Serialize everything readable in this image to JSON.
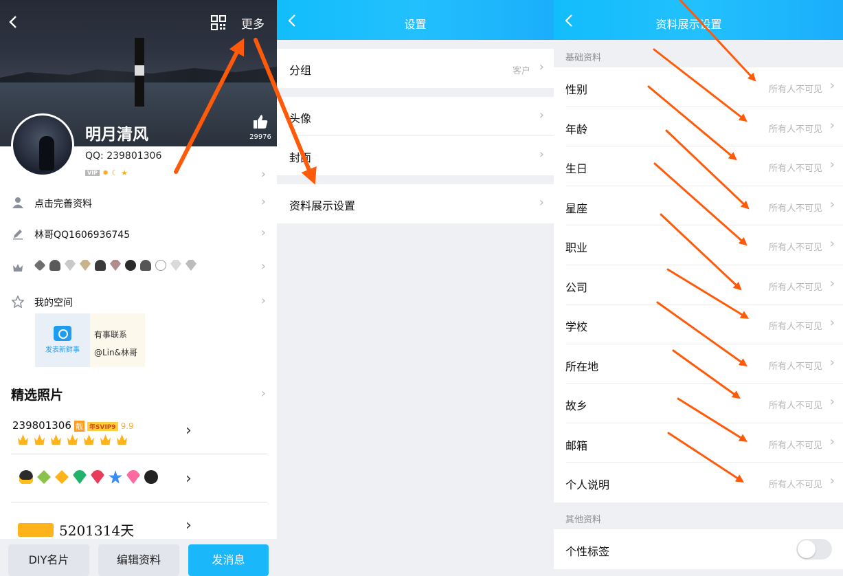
{
  "profile_panel": {
    "more_label": "更多",
    "nickname": "明月清风",
    "qq_number": "QQ: 239801306",
    "vip_badge": "VIP",
    "likes": "29976",
    "rows": [
      {
        "label": "点击完善资料"
      },
      {
        "label": "林哥QQ1606936745"
      },
      {
        "label": ""
      },
      {
        "label": "我的空间"
      }
    ],
    "space_card": {
      "post_label": "发表新鲜事",
      "text_line1": "有事联系",
      "text_line2": "@Lin&林哥"
    },
    "featured_title": "精选照片",
    "vip_row": {
      "qq": "239801306",
      "liang_tag": "靓",
      "svip_tag": "年SVIP9",
      "level": "9.9"
    },
    "days_row": {
      "value": "5201314天"
    },
    "buttons": {
      "diy": "DIY名片",
      "edit": "编辑资料",
      "message": "发消息"
    }
  },
  "settings_panel": {
    "title": "设置",
    "rows": [
      {
        "label": "分组",
        "value": "客户"
      },
      {
        "label": "头像",
        "value": ""
      },
      {
        "label": "封面",
        "value": ""
      },
      {
        "label": "资料展示设置",
        "value": ""
      }
    ]
  },
  "display_panel": {
    "title": "资料展示设置",
    "section_basic": "基础资料",
    "basic_rows": [
      {
        "label": "性别",
        "value": "所有人不可见"
      },
      {
        "label": "年龄",
        "value": "所有人不可见"
      },
      {
        "label": "生日",
        "value": "所有人不可见"
      },
      {
        "label": "星座",
        "value": "所有人不可见"
      },
      {
        "label": "职业",
        "value": "所有人不可见"
      },
      {
        "label": "公司",
        "value": "所有人不可见"
      },
      {
        "label": "学校",
        "value": "所有人不可见"
      },
      {
        "label": "所在地",
        "value": "所有人不可见"
      },
      {
        "label": "故乡",
        "value": "所有人不可见"
      },
      {
        "label": "邮箱",
        "value": "所有人不可见"
      },
      {
        "label": "个人说明",
        "value": "所有人不可见"
      }
    ],
    "section_other": "其他资料",
    "other_rows": [
      {
        "label": "个性标签",
        "toggle_on": false
      }
    ]
  },
  "colors": {
    "header_blue": "#1abcfb",
    "send_button": "#1ab8fb",
    "annotation_arrow": "#ff5a0a"
  },
  "icons": [
    "back-arrow-icon",
    "qr-code-icon",
    "thumbs-up-icon",
    "person-icon",
    "pencil-icon",
    "crown-icon",
    "star-icon",
    "camera-icon",
    "chevron-right-icon"
  ]
}
